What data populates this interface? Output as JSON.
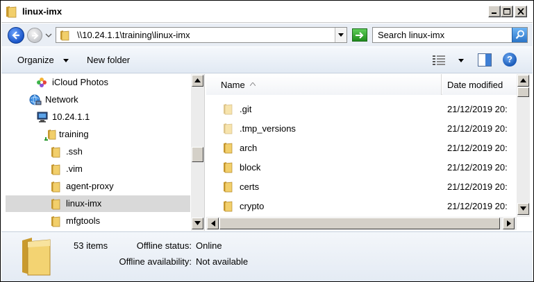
{
  "window": {
    "title": "linux-imx"
  },
  "address": {
    "path": "\\\\10.24.1.1\\training\\linux-imx",
    "search_placeholder": "Search linux-imx"
  },
  "toolbar": {
    "organize_label": "Organize",
    "new_folder_label": "New folder",
    "help_label": "?"
  },
  "nav_tree": {
    "items": [
      {
        "label": "iCloud Photos",
        "icon": "icloud-photos-icon"
      },
      {
        "label": "Network",
        "icon": "network-icon"
      },
      {
        "label": "10.24.1.1",
        "icon": "computer-icon"
      },
      {
        "label": "training",
        "icon": "shared-folder-icon"
      },
      {
        "label": ".ssh",
        "icon": "folder-icon"
      },
      {
        "label": ".vim",
        "icon": "folder-icon"
      },
      {
        "label": "agent-proxy",
        "icon": "folder-icon"
      },
      {
        "label": "linux-imx",
        "icon": "folder-icon",
        "selected": true
      },
      {
        "label": "mfgtools",
        "icon": "folder-icon"
      }
    ]
  },
  "file_list": {
    "columns": {
      "name": "Name",
      "date_modified": "Date modified"
    },
    "sort_column": "Name",
    "rows": [
      {
        "name": ".git",
        "date": "21/12/2019 20:",
        "hidden": true
      },
      {
        "name": ".tmp_versions",
        "date": "21/12/2019 20:",
        "hidden": true
      },
      {
        "name": "arch",
        "date": "21/12/2019 20:",
        "hidden": false
      },
      {
        "name": "block",
        "date": "21/12/2019 20:",
        "hidden": false
      },
      {
        "name": "certs",
        "date": "21/12/2019 20:",
        "hidden": false
      },
      {
        "name": "crypto",
        "date": "21/12/2019 20:",
        "hidden": false
      }
    ]
  },
  "details": {
    "item_count": "53 items",
    "offline_status_label": "Offline status:",
    "offline_status_value": "Online",
    "offline_availability_label": "Offline availability:",
    "offline_availability_value": "Not available"
  },
  "colors": {
    "folder": "#e8c35a",
    "folder_hidden": "#f1e2b3",
    "selection": "#d9d9d9",
    "accent_blue": "#1a55c8"
  }
}
